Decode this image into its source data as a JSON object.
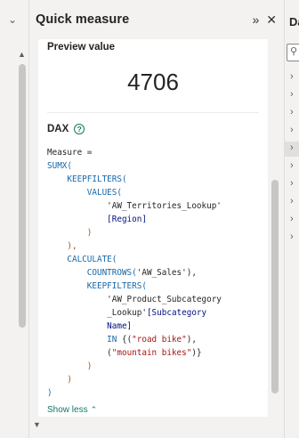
{
  "left_pane": {
    "collapse_icon": "chevron-down-icon",
    "scroll_up_icon": "caret-up-icon"
  },
  "quick_measure": {
    "title": "Quick measure",
    "expand_icon": "»",
    "close_icon": "✕",
    "preview_label": "Preview value",
    "preview_value": "4706",
    "dax_label": "DAX",
    "help_icon": "?",
    "show_less": "Show less",
    "code_lines": [
      [
        {
          "t": "Measure =",
          "c": "pl"
        }
      ],
      [
        {
          "t": "SUMX(",
          "c": "fn"
        }
      ],
      [
        {
          "t": "    KEEPFILTERS(",
          "c": "fn"
        }
      ],
      [
        {
          "t": "        VALUES(",
          "c": "fn"
        }
      ],
      [
        {
          "t": "            ",
          "c": "pl"
        },
        {
          "t": "'AW_Territories_Lookup'",
          "c": "pl"
        }
      ],
      [
        {
          "t": "            ",
          "c": "pl"
        },
        {
          "t": "[Region]",
          "c": "ref"
        }
      ],
      [
        {
          "t": "        )",
          "c": "br"
        }
      ],
      [
        {
          "t": "    ),",
          "c": "br"
        }
      ],
      [
        {
          "t": "    CALCULATE(",
          "c": "fn"
        }
      ],
      [
        {
          "t": "        COUNTROWS(",
          "c": "fn"
        },
        {
          "t": "'AW_Sales'",
          "c": "pl"
        },
        {
          "t": "),",
          "c": "pl"
        }
      ],
      [
        {
          "t": "        KEEPFILTERS(",
          "c": "fn"
        }
      ],
      [
        {
          "t": "            ",
          "c": "pl"
        },
        {
          "t": "'AW_Product_Subcategory",
          "c": "pl"
        }
      ],
      [
        {
          "t": "            ",
          "c": "pl"
        },
        {
          "t": "_Lookup'",
          "c": "pl"
        },
        {
          "t": "[Subcategory",
          "c": "ref"
        }
      ],
      [
        {
          "t": "            ",
          "c": "pl"
        },
        {
          "t": "Name]",
          "c": "ref"
        }
      ],
      [
        {
          "t": "            ",
          "c": "pl"
        },
        {
          "t": "IN",
          "c": "fn"
        },
        {
          "t": " {(",
          "c": "pl"
        },
        {
          "t": "\"road bike\"",
          "c": "str"
        },
        {
          "t": "),",
          "c": "pl"
        }
      ],
      [
        {
          "t": "            ",
          "c": "pl"
        },
        {
          "t": "(",
          "c": "pl"
        },
        {
          "t": "\"mountain bikes\"",
          "c": "str"
        },
        {
          "t": ")}",
          "c": "pl"
        }
      ],
      [
        {
          "t": "        )",
          "c": "br"
        }
      ],
      [
        {
          "t": "    )",
          "c": "br"
        }
      ],
      [
        {
          "t": ")",
          "c": "fn"
        }
      ]
    ]
  },
  "data_pane": {
    "title_partial": "Da",
    "search_icon": "search-icon",
    "tree_expanders": 10,
    "selected_index": 4
  }
}
